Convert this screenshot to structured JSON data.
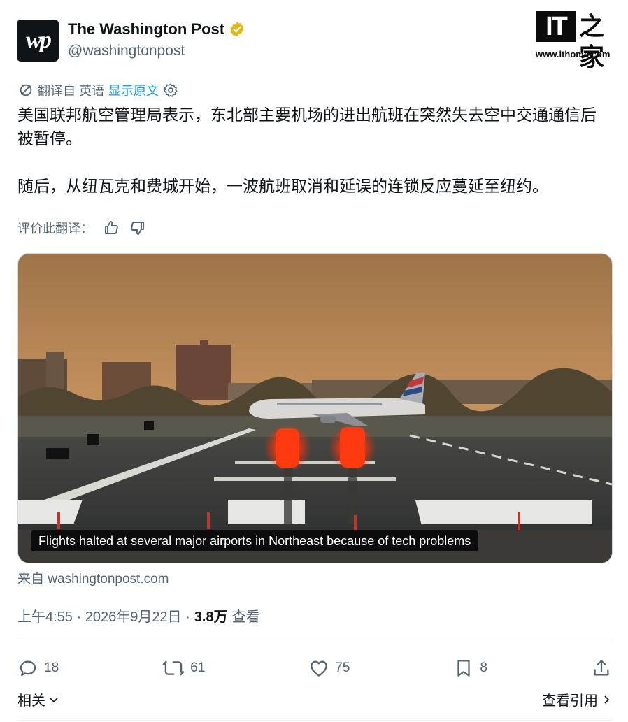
{
  "author": {
    "name": "The Washington Post",
    "handle": "@washingtonpost",
    "avatar_text": "wp"
  },
  "watermark": {
    "brand": "IT",
    "brand_zh": "之家",
    "url": "www.ithome.com"
  },
  "translation": {
    "from_label": "翻译自 英语",
    "show_original": "显示原文"
  },
  "tweet": {
    "paragraph1": "美国联邦航空管理局表示，东北部主要机场的进出航班在突然失去空中交通通信后被暂停。",
    "paragraph2": "随后，从纽瓦克和费城开始，一波航班取消和延误的连锁反应蔓延至纽约。"
  },
  "rate_label": "评价此翻译：",
  "card": {
    "caption": "Flights halted at several major airports in Northeast because of tech problems",
    "source": "来自 washingtonpost.com"
  },
  "meta": {
    "time": "上午4:55 · 2026年9月22日 · ",
    "views_count": "3.8万",
    "views_label": "查看"
  },
  "actions": {
    "replies": "18",
    "retweets": "61",
    "likes": "75",
    "bookmarks": "8"
  },
  "footer": {
    "related": "相关",
    "view_quotes": "查看引用"
  },
  "colors": {
    "link": "#1d9bf0",
    "secondary_text": "#536471",
    "verified_gold": "#e2b719"
  }
}
